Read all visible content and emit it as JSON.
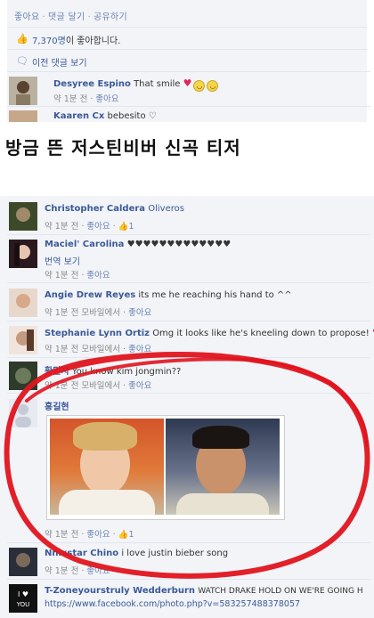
{
  "post_actions": {
    "like": "좋아요",
    "comment": "댓글 달기",
    "share": "공유하기"
  },
  "likes": {
    "count": "7,370명",
    "suffix": "이 좋아합니다."
  },
  "previous_comments_label": "이전 댓글 보기",
  "top_comments": [
    {
      "name": "Desyree Espino",
      "text": "That smile",
      "meta_time": "약 1분 전",
      "meta_like": "좋아요"
    },
    {
      "name": "Kaaren Cx",
      "text": "bebesito"
    }
  ],
  "headline": "방금 뜬 저스틴비버 신곡 티저",
  "comments": [
    {
      "name": "Christopher Caldera",
      "text": "Oliveros",
      "meta_time": "약 1분 전",
      "meta_like": "좋아요",
      "like_count": "1"
    },
    {
      "name": "Maciel' Carolina",
      "text": "♥♥♥♥♥♥♥♥♥♥♥♥♥",
      "translate": "번역 보기",
      "meta_time": "약 1분 전",
      "meta_like": "좋아요"
    },
    {
      "name": "Angie Drew Reyes",
      "text": "its me he reaching his hand to ^^",
      "meta_time": "약 1분 전 모바일에서",
      "meta_like": "좋아요"
    },
    {
      "name": "Stephanie Lynn Ortiz",
      "text": "Omg it looks like he's kneeling down to propose!",
      "meta_time": "약 1분 전 모바일에서",
      "meta_like": "좋아요"
    },
    {
      "name": "황민지",
      "text": "You know kim jongmin??",
      "meta_time": "약 1분 전 모바일에서",
      "meta_like": "좋아요"
    },
    {
      "name": "홍길현",
      "meta_time": "약 1분 전",
      "meta_like": "좋아요",
      "like_count": "1"
    },
    {
      "name": "Nnixstar Chino",
      "text": "i love justin bieber song",
      "meta_time": "약 1분 전",
      "meta_like": "좋아요"
    },
    {
      "name": "T-Zoneyourstruly Wedderburn",
      "text": "WATCH DRAKE HOLD ON WE'RE GOING H",
      "link": "https://www.facebook.com/photo.php?v=583257488378057"
    }
  ],
  "colors": {
    "link": "#3b5998",
    "annotation": "#e0141e",
    "background": "#f2f4f8"
  }
}
